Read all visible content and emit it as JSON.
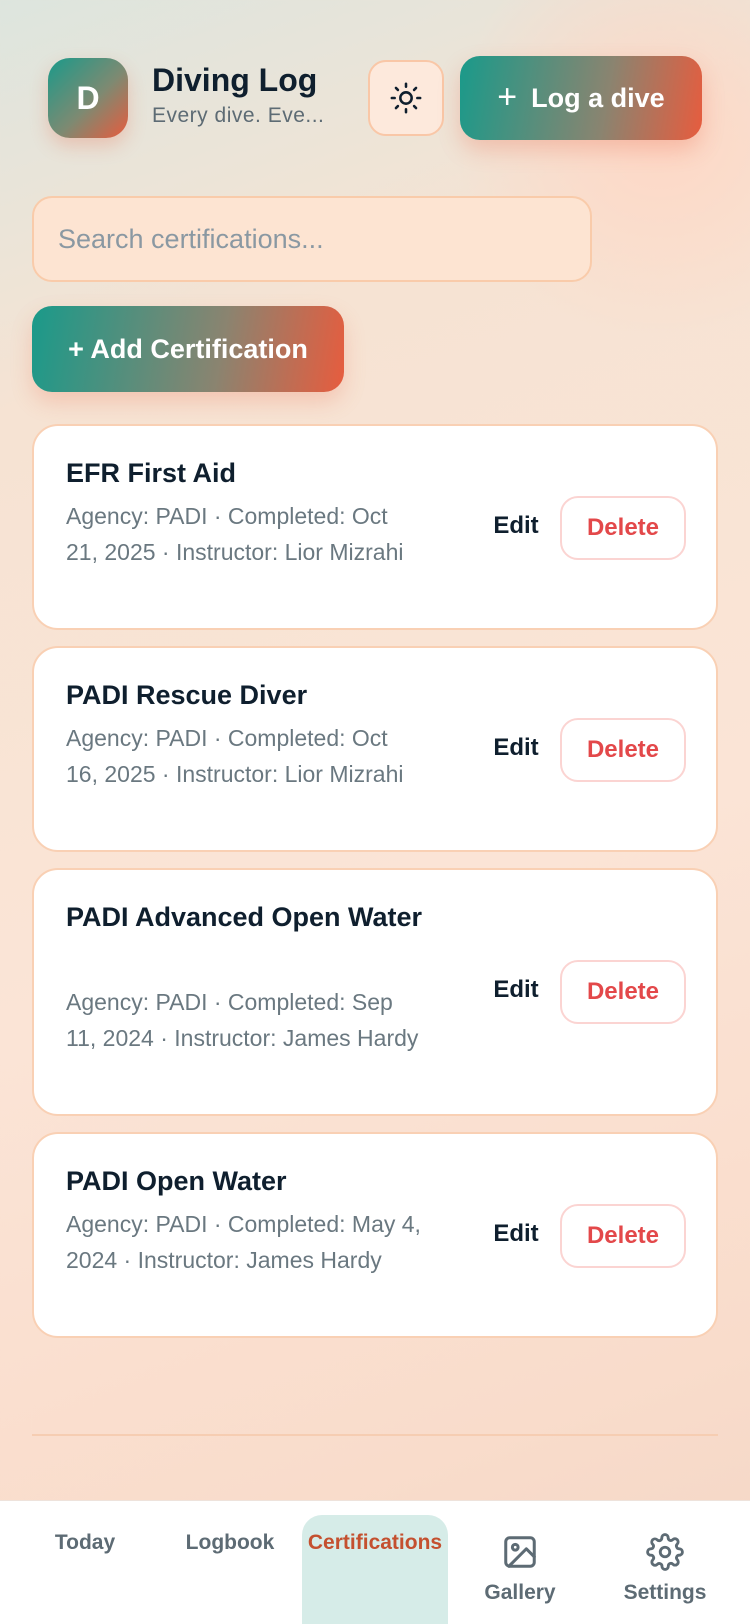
{
  "header": {
    "logo_letter": "D",
    "title": "Diving Log",
    "subtitle": "Every dive. Eve...",
    "theme_icon": "sun-icon",
    "log_button_label": "Log a dive",
    "log_button_icon": "+"
  },
  "search": {
    "placeholder": "Search certifications...",
    "value": ""
  },
  "add_button_label": "+ Add Certification",
  "certifications": [
    {
      "title": "EFR First Aid",
      "meta": "Agency: PADI · Completed: Oct 21, 2025 · Instructor: Lior Mizrahi",
      "edit_label": "Edit",
      "delete_label": "Delete"
    },
    {
      "title": "PADI Rescue Diver",
      "meta": "Agency: PADI · Completed: Oct 16, 2025 · Instructor: Lior Mizrahi",
      "edit_label": "Edit",
      "delete_label": "Delete"
    },
    {
      "title": "PADI Advanced Open Water",
      "meta": "Agency: PADI · Completed: Sep 11, 2024 · Instructor: James Hardy",
      "edit_label": "Edit",
      "delete_label": "Delete"
    },
    {
      "title": "PADI Open Water",
      "meta": "Agency: PADI · Completed: May 4, 2024 · Instructor: James Hardy",
      "edit_label": "Edit",
      "delete_label": "Delete"
    }
  ],
  "nav": {
    "today": "Today",
    "logbook": "Logbook",
    "certifications": "Certifications",
    "gallery": "Gallery",
    "settings": "Settings",
    "active": "certifications"
  },
  "colors": {
    "accent_teal": "#1a9a8a",
    "accent_coral": "#e75c3e",
    "delete_red": "#e3484a",
    "active_nav_text": "#c4502f",
    "active_nav_bg": "#d6ece8"
  }
}
